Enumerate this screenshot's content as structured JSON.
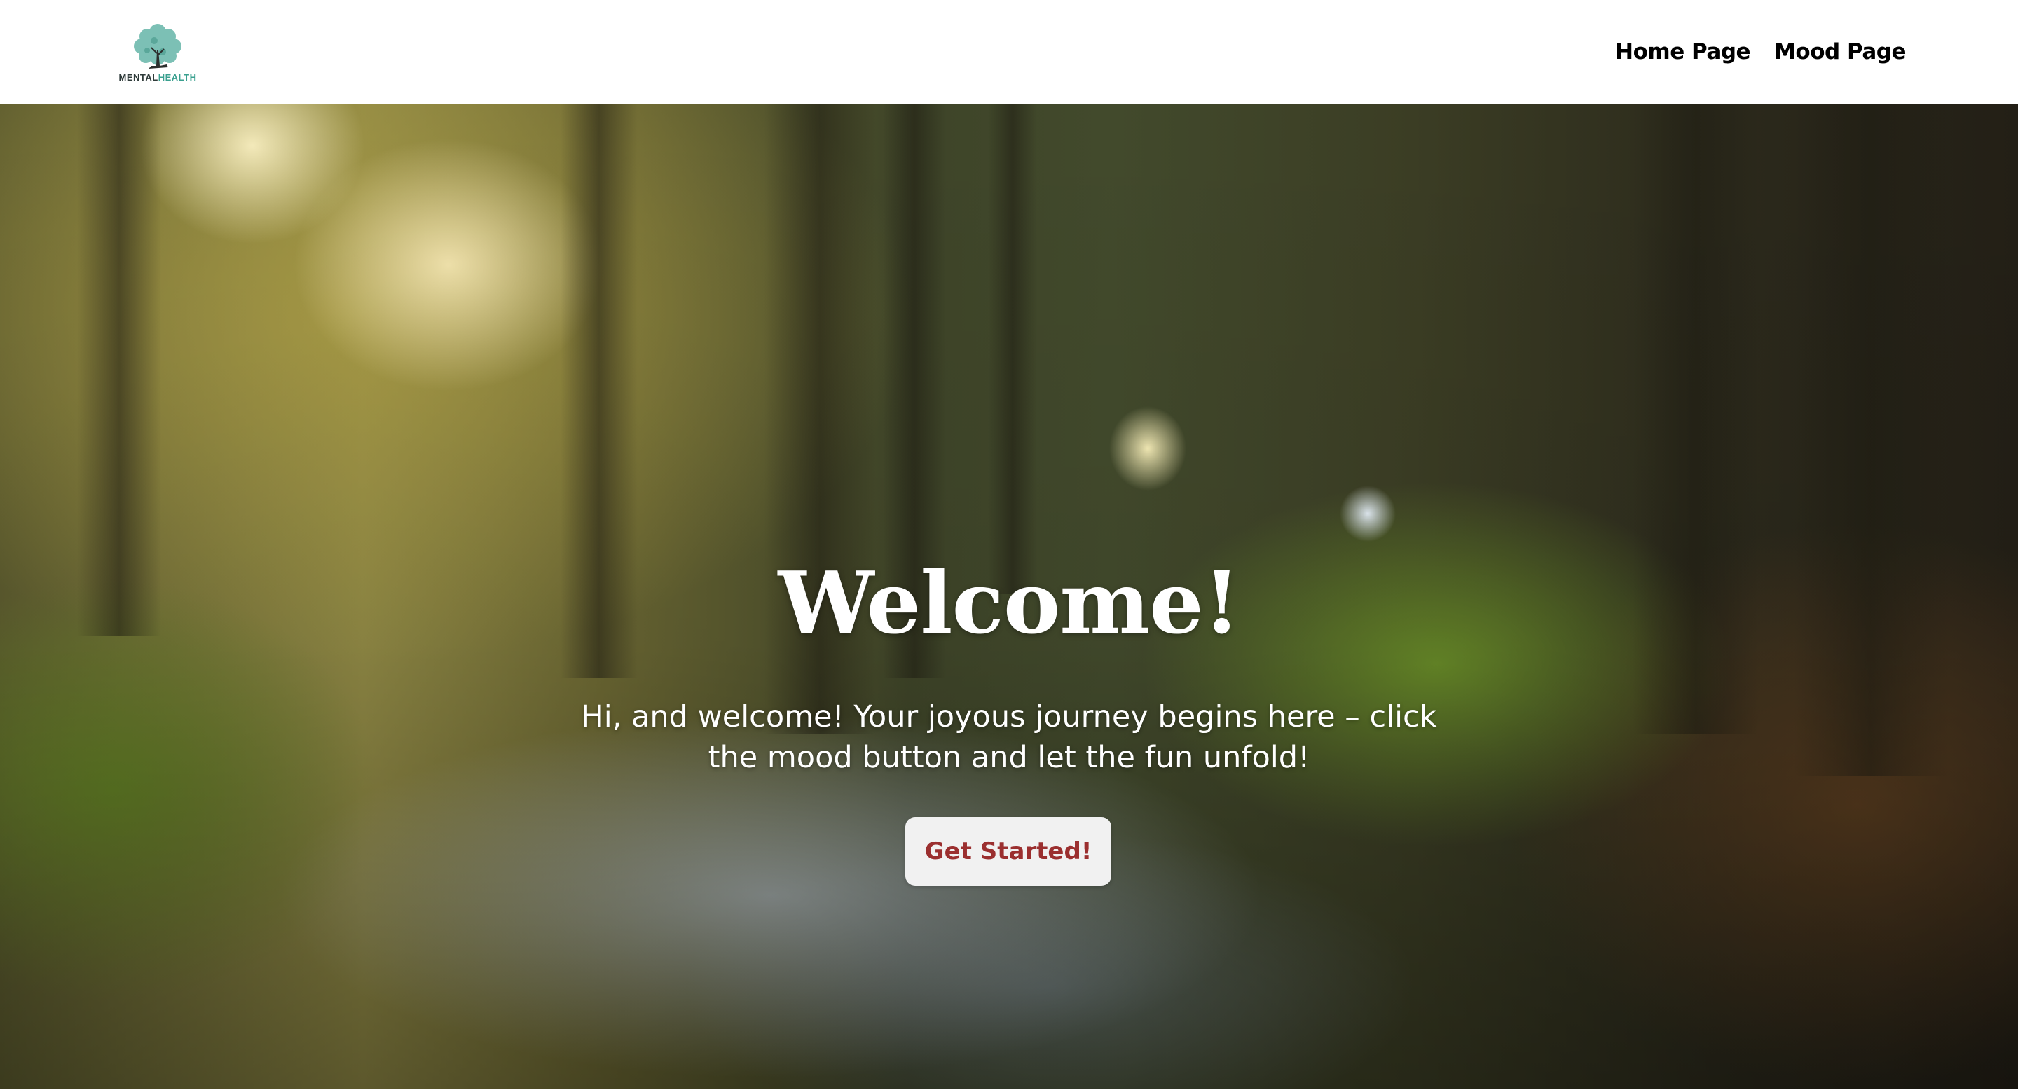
{
  "navbar": {
    "logo": {
      "icon": "tree-icon",
      "word1": "MENTAL",
      "word2": "HEALTH",
      "colors": {
        "leaves": "#7cc0b5",
        "text_dark": "#2f3b3a",
        "text_accent": "#3aa08f"
      }
    },
    "links": [
      {
        "label": "Home Page"
      },
      {
        "label": "Mood Page"
      }
    ]
  },
  "hero": {
    "background": "forest-stream-photo",
    "title": "Welcome!",
    "subtitle": "Hi, and welcome! Your joyous journey begins here – click the mood button and let the fun unfold!",
    "cta_label": "Get Started!",
    "cta_color": "#9b2f2f"
  }
}
